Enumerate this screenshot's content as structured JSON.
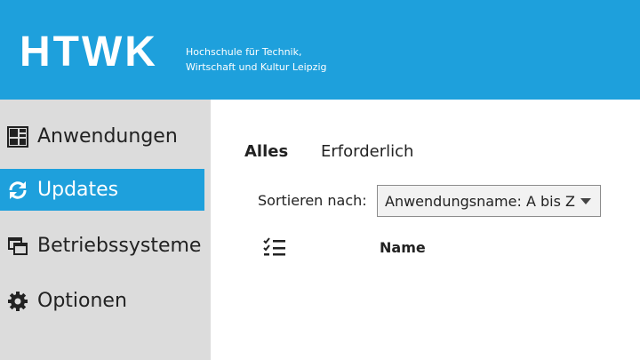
{
  "header": {
    "logo_text": "HTWK",
    "subtitle_line1": "Hochschule für Technik,",
    "subtitle_line2": "Wirtschaft und Kultur Leipzig",
    "background_color": "#1ea0dc"
  },
  "sidebar": {
    "items": [
      {
        "label": "Anwendungen",
        "icon": "apps-grid-icon",
        "active": false
      },
      {
        "label": "Updates",
        "icon": "refresh-icon",
        "active": true
      },
      {
        "label": "Betriebssysteme",
        "icon": "windows-stack-icon",
        "active": false
      },
      {
        "label": "Optionen",
        "icon": "gear-icon",
        "active": false
      }
    ]
  },
  "main": {
    "tabs": [
      {
        "label": "Alles",
        "active": true
      },
      {
        "label": "Erforderlich",
        "active": false
      }
    ],
    "sort": {
      "label": "Sortieren nach:",
      "selected": "Anwendungsname: A bis Z"
    },
    "table": {
      "select_all_icon": "checklist-icon",
      "columns": [
        "Name"
      ]
    }
  }
}
